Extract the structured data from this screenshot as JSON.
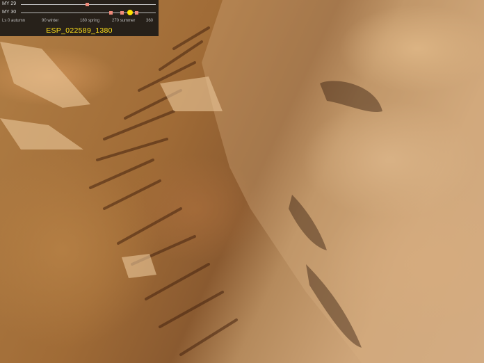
{
  "legend": {
    "rows": [
      {
        "label": "MY 29"
      },
      {
        "label": "MY 30"
      }
    ],
    "ticks": [
      {
        "value": "L",
        "season": "0 autumn"
      },
      {
        "value": "90",
        "season": "winter"
      },
      {
        "value": "180",
        "season": "spring"
      },
      {
        "value": "270",
        "season": "summer"
      },
      {
        "value": "360",
        "season": ""
      }
    ],
    "image_id": "ESP_022589_1380",
    "colors": {
      "marker": "#f08a7a",
      "current": "#ffe400",
      "text_id": "#ffe11a"
    }
  }
}
